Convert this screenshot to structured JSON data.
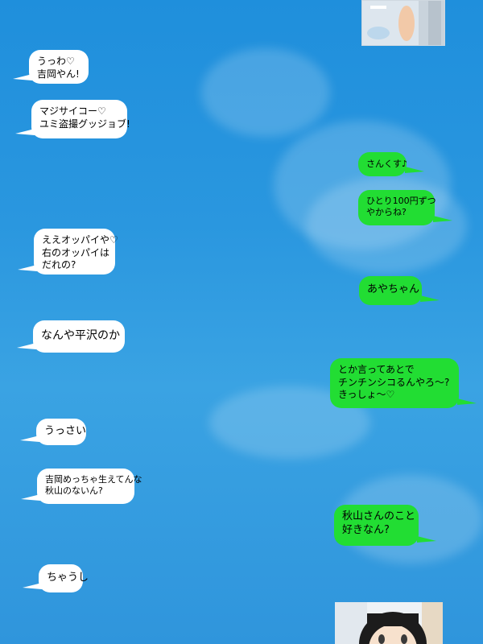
{
  "messages": {
    "m1": {
      "lines": [
        "うっわ♡",
        "吉岡やん!"
      ]
    },
    "m2": {
      "lines": [
        "マジサイコー♡",
        "ユミ盗撮グッジョブ!"
      ]
    },
    "m3": {
      "lines": [
        "さんくす♪"
      ]
    },
    "m4": {
      "lines": [
        "ひとり100円ずつ",
        "やからね?"
      ]
    },
    "m5": {
      "lines": [
        "ええオッパイや♡",
        "右のオッパイは",
        "だれの?"
      ]
    },
    "m6": {
      "lines": [
        "あやちゃん"
      ]
    },
    "m7": {
      "lines": [
        "なんや平沢のか"
      ]
    },
    "m8": {
      "lines": [
        "とか言ってあとで",
        "チンチンシコるんやろ〜?",
        "きっしょ〜♡"
      ]
    },
    "m9": {
      "lines": [
        "うっさい"
      ]
    },
    "m10": {
      "lines": [
        "吉岡めっちゃ生えてんな",
        "秋山のないん?"
      ]
    },
    "m11": {
      "lines": [
        "秋山さんのこと",
        "好きなん?"
      ]
    },
    "m12": {
      "lines": [
        "ちゃうし"
      ]
    }
  },
  "colors": {
    "sky": "#2a97df",
    "left_bubble": "#ffffff",
    "right_bubble": "#22dd33"
  },
  "images": {
    "top_photo": "photo-thumbnail",
    "bottom_photo": "photo-thumbnail"
  }
}
